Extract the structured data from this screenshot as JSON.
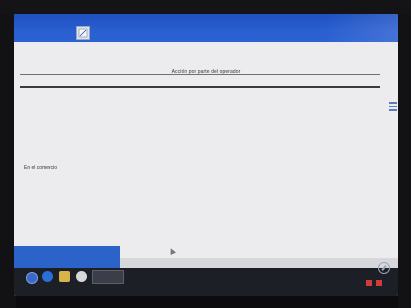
{
  "window": {
    "app_icon": "document-icon",
    "titlebar_color": "#2a5fd0"
  },
  "header": {
    "title": "Acción por parte del operador"
  },
  "body": {
    "status_text": "En el comercio"
  },
  "sidebar": {
    "menu_icon": "menu-icon"
  },
  "taskbar": {
    "icons": [
      "start-icon",
      "browser-icon",
      "folder-icon",
      "app-icon"
    ],
    "search": "",
    "tray_icons": [
      "network-icon",
      "volume-icon",
      "battery-icon",
      "notification-icon"
    ]
  },
  "colors": {
    "accent": "#2b63c9",
    "background": "#ececef",
    "taskbar": "#1d1f26"
  }
}
